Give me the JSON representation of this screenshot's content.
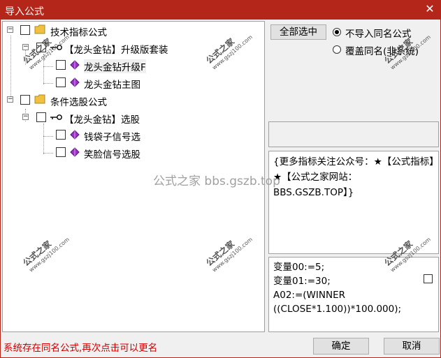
{
  "window": {
    "title": "导入公式",
    "close_glyph": "✕"
  },
  "tree": {
    "nodes": [
      {
        "label": "技术指标公式",
        "icon": "folder-icon",
        "expander": "−"
      },
      {
        "label": "【龙头金钻】升级版套装",
        "icon": "key-icon",
        "expander": "−"
      },
      {
        "label": "龙头金钻升级F",
        "icon": "gem-icon"
      },
      {
        "label": "龙头金钻主图",
        "icon": "gem-icon"
      },
      {
        "label": "条件选股公式",
        "icon": "folder-icon",
        "expander": "−"
      },
      {
        "label": "【龙头金钻】选股",
        "icon": "key-icon",
        "expander": "−"
      },
      {
        "label": "钱袋子信号选",
        "icon": "gem-icon"
      },
      {
        "label": "笑脸信号选股",
        "icon": "gem-icon"
      }
    ]
  },
  "options": {
    "select_all_label": "全部选中",
    "radio_no_import": "不导入同名公式",
    "radio_overwrite": "覆盖同名(非系统)",
    "selected": "no_import"
  },
  "description": "{更多指标关注公众号：★【公式指标】★【公式之家网站：BBS.GSZB.TOP】}",
  "code": [
    "变量00:=5;",
    "变量01:=30;",
    "A02:=(WINNER",
    "((CLOSE*1.100))*100.000);"
  ],
  "status_message": "系统存在同名公式,再次点击可以更名",
  "buttons": {
    "ok_label": "确定",
    "cancel_label": "取消"
  },
  "watermarks": {
    "center": "公式之家 bbs.gszb.top",
    "brand": "公式之家",
    "site": "www.gszj100.com"
  },
  "colors": {
    "title_bar": "#b5261a",
    "status_text": "#d00000",
    "gem": "#9b30c8",
    "folder": "#f0c040"
  }
}
